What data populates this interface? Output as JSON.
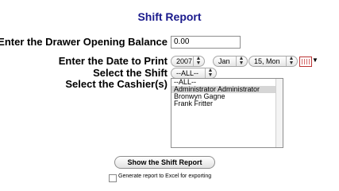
{
  "title": "Shift Report",
  "form": {
    "opening_balance_label": "Enter the Drawer Opening Balance",
    "opening_balance_value": "0.00",
    "date_label": "Enter the Date to Print",
    "date_year": "2007",
    "date_month": "Jan",
    "date_day": "15, Mon",
    "shift_label": "Select the Shift",
    "shift_value": "--ALL--",
    "cashier_label": "Select the Cashier(s)",
    "cashiers": [
      "--ALL--",
      "Administrator Administrator",
      "Bronwyn Gagne",
      "Frank Fritter"
    ],
    "selected_cashier": "Administrator Administrator"
  },
  "actions": {
    "show_report_label": "Show the Shift Report",
    "excel_label": "Generate report to Excel for exporting"
  },
  "icons": {
    "calendar": "calendar-icon",
    "select_arrows": "updown-arrows-icon"
  },
  "colors": {
    "title": "#1a1a8c",
    "selected_row": "#d6d6d6"
  }
}
